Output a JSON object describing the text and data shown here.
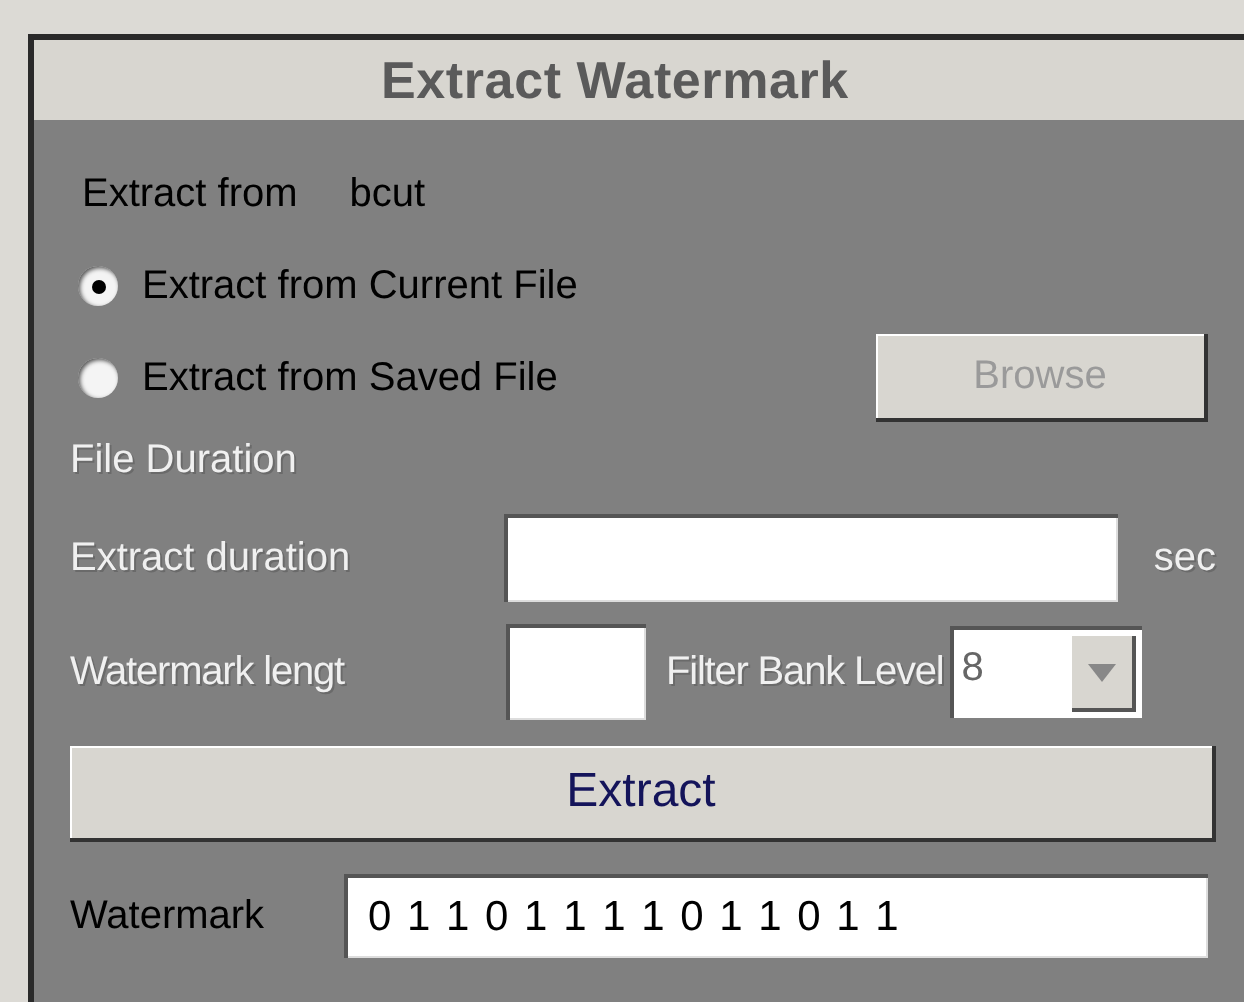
{
  "panel": {
    "title": "Extract Watermark"
  },
  "source": {
    "label": "Extract from",
    "value": "bcut"
  },
  "options": [
    {
      "label": "Extract from Current File",
      "selected": true
    },
    {
      "label": "Extract from Saved File",
      "selected": false
    }
  ],
  "browse_button": {
    "label": "Browse",
    "disabled": true
  },
  "file_duration": {
    "label": "File Duration",
    "disabled": true
  },
  "extract_duration": {
    "label": "Extract duration",
    "disabled": true,
    "unit": "sec"
  },
  "watermark_length": {
    "label": "Watermark lengt",
    "disabled": true
  },
  "filter_bank": {
    "label": "Filter Bank Level",
    "disabled": true,
    "value": "8"
  },
  "extract_button": {
    "label": "Extract"
  },
  "watermark": {
    "label": "Watermark",
    "value": "0 1 1 0 1 1 1 1 0 1 1 0 1 1"
  }
}
